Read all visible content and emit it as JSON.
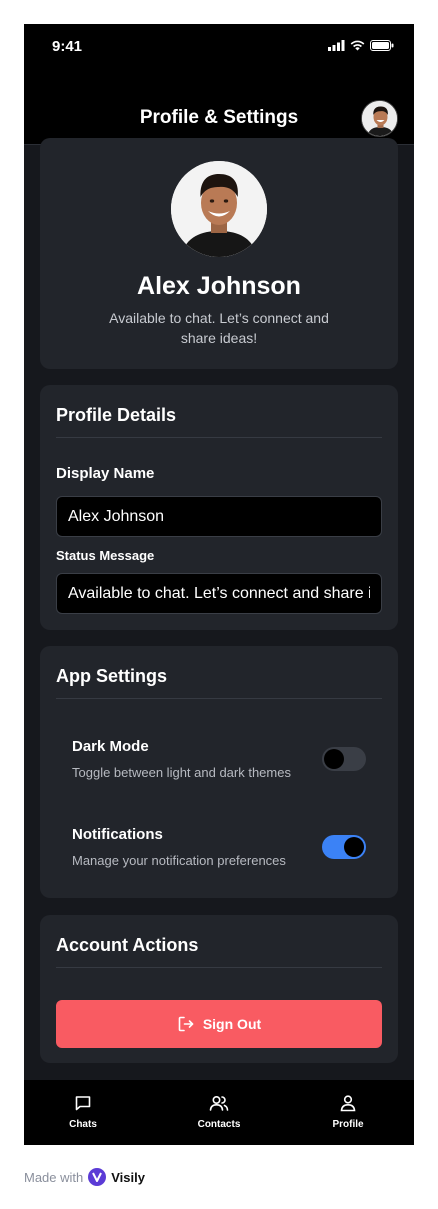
{
  "status_bar": {
    "time": "9:41"
  },
  "header": {
    "title": "Profile & Settings"
  },
  "profile": {
    "name": "Alex Johnson",
    "status": "Available to chat. Let’s connect and share ideas!"
  },
  "profile_details": {
    "heading": "Profile Details",
    "display_name_label": "Display Name",
    "display_name_value": "Alex Johnson",
    "status_label": "Status Message",
    "status_value": "Available to chat. Let’s connect and share ideas!"
  },
  "app_settings": {
    "heading": "App Settings",
    "dark_mode": {
      "title": "Dark Mode",
      "description": "Toggle between light and dark themes",
      "enabled": false
    },
    "notifications": {
      "title": "Notifications",
      "description": "Manage your notification preferences",
      "enabled": true
    }
  },
  "account": {
    "heading": "Account Actions",
    "signout_label": "Sign Out"
  },
  "tabs": [
    {
      "label": "Chats",
      "icon": "chat-icon"
    },
    {
      "label": "Contacts",
      "icon": "contacts-icon"
    },
    {
      "label": "Profile",
      "icon": "profile-icon",
      "active": true
    }
  ],
  "footer": {
    "made_with": "Made with",
    "brand": "Visily"
  },
  "colors": {
    "background": "#16181d",
    "card": "#22252b",
    "accent": "#3b82f6",
    "danger": "#f95b62"
  }
}
